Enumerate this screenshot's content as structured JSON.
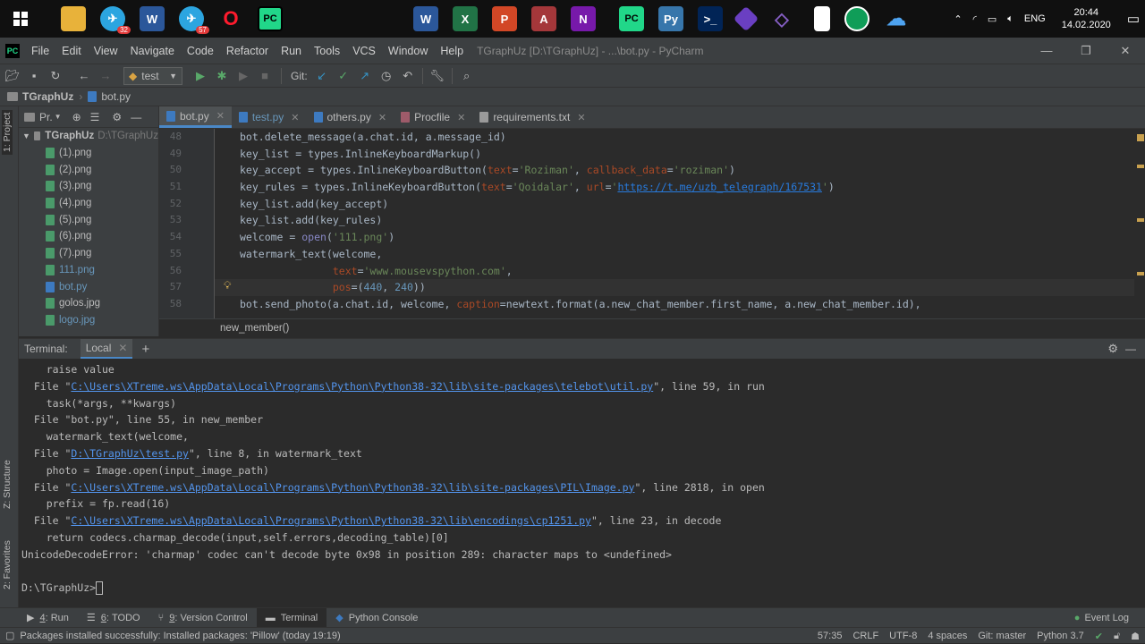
{
  "taskbar": {
    "badges": {
      "telegram": "32",
      "other": "57"
    },
    "tray": {
      "lang": "ENG",
      "time": "20:44",
      "date": "14.02.2020"
    }
  },
  "window": {
    "menus": [
      "File",
      "Edit",
      "View",
      "Navigate",
      "Code",
      "Refactor",
      "Run",
      "Tools",
      "VCS",
      "Window",
      "Help"
    ],
    "title": "TGraphUz [D:\\TGraphUz] - ...\\bot.py - PyCharm"
  },
  "toolbar": {
    "run_config": "test",
    "git_label": "Git:"
  },
  "navbar": {
    "project": "TGraphUz",
    "file": "bot.py"
  },
  "project_panel": {
    "header": "Pr.",
    "root": "TGraphUz",
    "root_path": "D:\\TGraphUz",
    "files": [
      "(1).png",
      "(2).png",
      "(3).png",
      "(4).png",
      "(5).png",
      "(6).png",
      "(7).png",
      "111.png",
      "bot.py",
      "golos.jpg",
      "logo.jpg"
    ]
  },
  "side_labels": {
    "project": "1: Project",
    "structure": "Z: Structure",
    "favorites": "2: Favorites"
  },
  "tabs": [
    "bot.py",
    "test.py",
    "others.py",
    "Procfile",
    "requirements.txt"
  ],
  "editor": {
    "line_numbers": [
      "48",
      "49",
      "50",
      "51",
      "52",
      "53",
      "54",
      "55",
      "56",
      "57",
      "58"
    ],
    "breadcrumb": "new_member()"
  },
  "terminal": {
    "label": "Terminal:",
    "tab": "Local",
    "add": "+",
    "lines": [
      {
        "pre": "    raise value",
        "link": "",
        "post": ""
      },
      {
        "pre": "  File \"",
        "link": "C:\\Users\\XTreme.ws\\AppData\\Local\\Programs\\Python\\Python38-32\\lib\\site-packages\\telebot\\util.py",
        "post": "\", line 59, in run"
      },
      {
        "pre": "    task(*args, **kwargs)",
        "link": "",
        "post": ""
      },
      {
        "pre": "  File \"bot.py\", line 55, in new_member",
        "link": "",
        "post": ""
      },
      {
        "pre": "    watermark_text(welcome,",
        "link": "",
        "post": ""
      },
      {
        "pre": "  File \"",
        "link": "D:\\TGraphUz\\test.py",
        "post": "\", line 8, in watermark_text"
      },
      {
        "pre": "    photo = Image.open(input_image_path)",
        "link": "",
        "post": ""
      },
      {
        "pre": "  File \"",
        "link": "C:\\Users\\XTreme.ws\\AppData\\Local\\Programs\\Python\\Python38-32\\lib\\site-packages\\PIL\\Image.py",
        "post": "\", line 2818, in open"
      },
      {
        "pre": "    prefix = fp.read(16)",
        "link": "",
        "post": ""
      },
      {
        "pre": "  File \"",
        "link": "C:\\Users\\XTreme.ws\\AppData\\Local\\Programs\\Python\\Python38-32\\lib\\encodings\\cp1251.py",
        "post": "\", line 23, in decode"
      },
      {
        "pre": "    return codecs.charmap_decode(input,self.errors,decoding_table)[0]",
        "link": "",
        "post": ""
      },
      {
        "pre": "UnicodeDecodeError: 'charmap' codec can't decode byte 0x98 in position 289: character maps to <undefined>",
        "link": "",
        "post": ""
      },
      {
        "pre": "",
        "link": "",
        "post": ""
      },
      {
        "pre": "D:\\TGraphUz>",
        "link": "",
        "post": ""
      }
    ]
  },
  "bottom_tools": [
    {
      "num": "4",
      "label": "Run"
    },
    {
      "num": "6",
      "label": "TODO"
    },
    {
      "num": "9",
      "label": "Version Control"
    },
    {
      "num": "",
      "label": "Terminal"
    },
    {
      "num": "",
      "label": "Python Console"
    }
  ],
  "event_log": "Event Log",
  "status": {
    "message": "Packages installed successfully: Installed packages: 'Pillow' (today 19:19)",
    "position": "57:35",
    "line_sep": "CRLF",
    "encoding": "UTF-8",
    "indent": "4 spaces",
    "git": "Git: master",
    "interpreter": "Python 3.7"
  }
}
